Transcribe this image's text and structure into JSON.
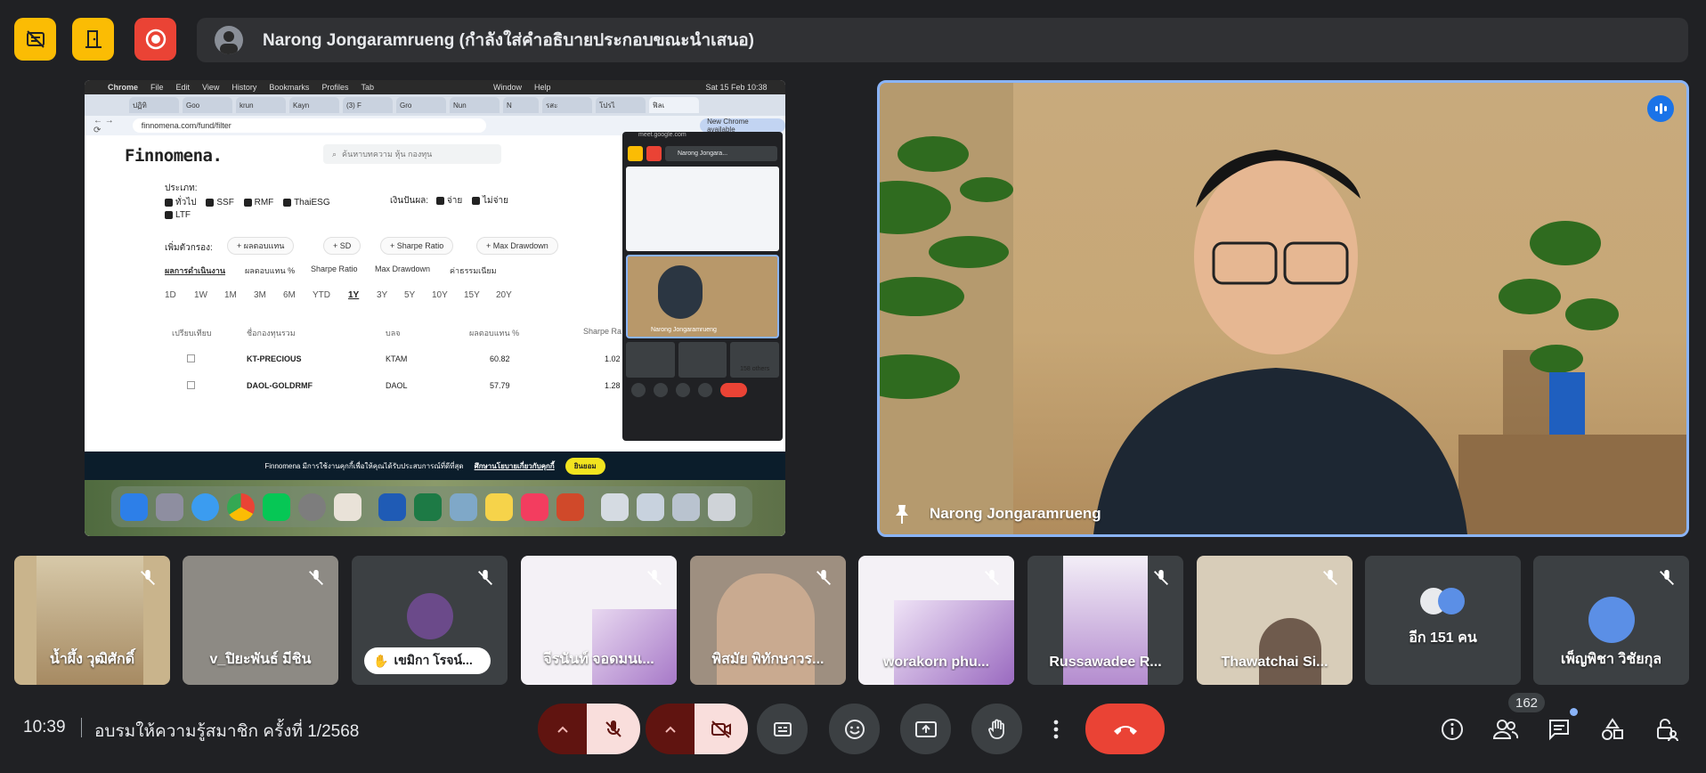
{
  "top_bar": {
    "presenter_text": "Narong Jongaramrueng (กำลังใส่คำอธิบายประกอบขณะนำเสนอ)"
  },
  "shared_screen": {
    "menubar": [
      "Chrome",
      "File",
      "Edit",
      "View",
      "History",
      "Bookmarks",
      "Profiles",
      "Tab",
      "Window",
      "Help",
      "Sat 15 Feb 10:38"
    ],
    "tabs": [
      "ปฏิทิ",
      "Goo",
      "krun",
      "Kayn",
      "(3) F",
      "Gro",
      "Nun",
      "N",
      "รสะ",
      "โปรไ",
      "ฟิลเ"
    ],
    "url": "finnomena.com/fund/filter",
    "new_chrome": "New Chrome available",
    "logo": "Finnomena.",
    "search_placeholder": "ค้นหาบทความ หุ้น กองทุน",
    "type_label": "ประเภท:",
    "types": [
      "ทั่วไป",
      "SSF",
      "RMF",
      "ThaiESG",
      "LTF"
    ],
    "dividend_label": "เงินปันผล:",
    "dividend_opts": [
      "จ่าย",
      "ไม่จ่าย"
    ],
    "add_filter_label": "เพิ่มตัวกรอง:",
    "filter_chips": [
      "ผลตอบแทน",
      "SD",
      "Sharpe Ratio",
      "Max Drawdown"
    ],
    "subtabs": [
      "ผลการดำเนินงาน",
      "ผลตอบแทน %",
      "Sharpe Ratio",
      "Max Drawdown",
      "ค่าธรรมเนียม"
    ],
    "periods": [
      "1D",
      "1W",
      "1M",
      "3M",
      "6M",
      "YTD",
      "1Y",
      "3Y",
      "5Y",
      "10Y",
      "15Y",
      "20Y"
    ],
    "columns": [
      "เปรียบเทียบ",
      "ชื่อกองทุนรวม",
      "บลจ",
      "ผลตอบแทน %",
      "Sharpe Ra"
    ],
    "rows": [
      {
        "name": "KT-PRECIOUS",
        "amc": "KTAM",
        "ret": "60.82",
        "sharpe": "1.02"
      },
      {
        "name": "DAOL-GOLDRMF",
        "amc": "DAOL",
        "ret": "57.79",
        "sharpe": "1.28"
      }
    ],
    "cookie_text": "Finnomena มีการใช้งานคุกกี้เพื่อให้คุณได้รับประสบการณ์ที่ดีที่สุด",
    "cookie_link": "ศึกษานโยบายเกี่ยวกับคุกกี้",
    "cookie_button": "ยินยอม",
    "mini_meet": {
      "url": "meet.google.com",
      "presenter": "Narong Jongara...",
      "speaker_name": "Narong Jongaramrueng",
      "others": "158 others"
    }
  },
  "speaker": {
    "name": "Narong Jongaramrueng"
  },
  "participants": [
    {
      "name": "น้ำผึ้ง วุฒิศักดิ์",
      "muted": true
    },
    {
      "name": "v_ปิยะพันธ์ มีชิน",
      "muted": true
    },
    {
      "name": "เขมิกา โรจน์...",
      "muted": true,
      "hand_raised": true
    },
    {
      "name": "จีรนันท์ จอดมนเ...",
      "muted": true
    },
    {
      "name": "พิสมัย พิทักษาวร...",
      "muted": true
    },
    {
      "name": "worakorn phu...",
      "muted": true
    },
    {
      "name": "Russawadee R...",
      "muted": true
    },
    {
      "name": "Thawatchai Si...",
      "muted": true
    },
    {
      "name": "อีก 151 คน",
      "muted": false
    },
    {
      "name": "เพ็ญพิชา วิชัยกุล",
      "muted": true
    }
  ],
  "bottom_bar": {
    "time": "10:39",
    "meeting_title": "อบรมให้ความรู้สมาชิก ครั้งที่ 1/2568",
    "participant_count": "162"
  },
  "colors": {
    "background": "#202124",
    "accent": "#8ab4f8",
    "danger": "#ea4335",
    "warning": "#fbbc04"
  }
}
